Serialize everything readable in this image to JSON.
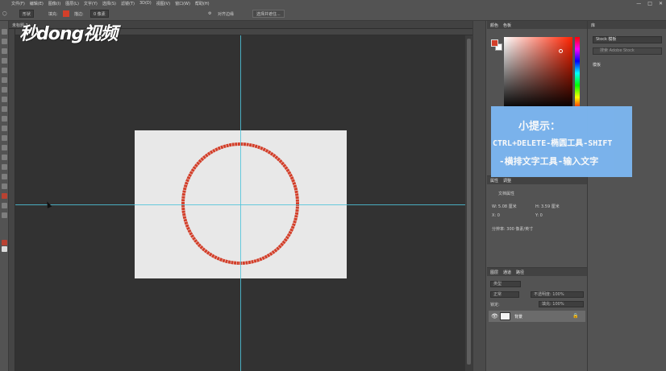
{
  "app": {
    "menu": [
      "文件(F)",
      "编辑(E)",
      "图像(I)",
      "图层(L)",
      "文字(Y)",
      "选择(S)",
      "滤镜(T)",
      "3D(D)",
      "视图(V)",
      "窗口(W)",
      "帮助(H)"
    ],
    "window_controls": [
      "—",
      "□",
      "✕"
    ]
  },
  "options_bar": {
    "mode": "形状",
    "fill_label": "填充:",
    "stroke_label": "描边:",
    "stroke_width": "0 像素",
    "align_label": "对齐边缘",
    "select_button": "选择并遮住..."
  },
  "document": {
    "tab_title": "未标题-1"
  },
  "watermark": {
    "text": "秒dong视频"
  },
  "colors": {
    "accent": "#d33f2a",
    "guide": "#4fc3d9",
    "tip_bg": "#7cb6f0",
    "canvas_bg": "#e8e8e8"
  },
  "color_panel": {
    "tabs": [
      "颜色",
      "色板"
    ]
  },
  "library_panel": {
    "tab": "库",
    "select_value": "Stock 模板",
    "search_placeholder": "搜索 Adobe Stock",
    "item": "模板"
  },
  "properties_panel": {
    "tabs": [
      "属性",
      "调整"
    ],
    "section": "文档属性",
    "w": "W: 5.08 厘米",
    "h": "H: 3.59 厘米",
    "x": "X: 0",
    "y": "Y: 0",
    "resolution": "分辨率: 300 像素/英寸"
  },
  "layers_panel": {
    "tabs": [
      "图层",
      "通道",
      "路径"
    ],
    "kind": "类型",
    "blend": "正常",
    "opacity": "不透明度: 100%",
    "lock_label": "锁定:",
    "fill": "填充: 100%",
    "layer_name": "背景"
  },
  "tip": {
    "title": "小提示：",
    "line1": "CTRL+DELETE-椭圆工具-SHIFT",
    "line2": "-横排文字工具-输入文字"
  }
}
